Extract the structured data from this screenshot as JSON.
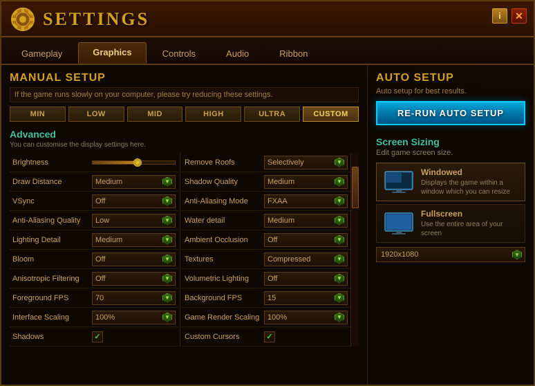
{
  "window": {
    "title": "SETTINGS",
    "close_label": "✕",
    "info_label": "i"
  },
  "tabs": [
    {
      "label": "Gameplay",
      "active": false
    },
    {
      "label": "Graphics",
      "active": true
    },
    {
      "label": "Controls",
      "active": false
    },
    {
      "label": "Audio",
      "active": false
    },
    {
      "label": "Ribbon",
      "active": false
    }
  ],
  "manual_setup": {
    "header": "MANUAL SETUP",
    "description": "If the game runs slowly on your computer, please try reducing these settings.",
    "presets": [
      "MIN",
      "LOW",
      "MID",
      "HIGH",
      "ULTRA",
      "CUSTOM"
    ],
    "active_preset": "CUSTOM"
  },
  "advanced": {
    "header": "Advanced",
    "description": "You can customise the display settings here."
  },
  "settings_left": [
    {
      "label": "Brightness",
      "type": "slider",
      "value": "55"
    },
    {
      "label": "Draw Distance",
      "type": "dropdown",
      "value": "Medium"
    },
    {
      "label": "VSync",
      "type": "dropdown",
      "value": "Off"
    },
    {
      "label": "Anti-Aliasing Quality",
      "type": "dropdown",
      "value": "Low"
    },
    {
      "label": "Lighting Detail",
      "type": "dropdown",
      "value": "Medium"
    },
    {
      "label": "Bloom",
      "type": "dropdown",
      "value": "Off"
    },
    {
      "label": "Anisotropic Filtering",
      "type": "dropdown",
      "value": "Off"
    },
    {
      "label": "Foreground FPS",
      "type": "dropdown",
      "value": "70"
    },
    {
      "label": "Interface Scaling",
      "type": "dropdown",
      "value": "100%"
    },
    {
      "label": "Shadows",
      "type": "checkbox",
      "value": true
    }
  ],
  "settings_right": [
    {
      "label": "Remove Roofs",
      "type": "dropdown",
      "value": "Selectively"
    },
    {
      "label": "Shadow Quality",
      "type": "dropdown",
      "value": "Medium"
    },
    {
      "label": "Anti-Aliasing Mode",
      "type": "dropdown",
      "value": "FXAA"
    },
    {
      "label": "Water detail",
      "type": "dropdown",
      "value": "Medium"
    },
    {
      "label": "Ambient Occlusion",
      "type": "dropdown",
      "value": "Off"
    },
    {
      "label": "Textures",
      "type": "dropdown",
      "value": "Compressed"
    },
    {
      "label": "Volumetric Lighting",
      "type": "dropdown",
      "value": "Off"
    },
    {
      "label": "Background FPS",
      "type": "dropdown",
      "value": "15"
    },
    {
      "label": "Game Render Scaling",
      "type": "dropdown",
      "value": "100%"
    },
    {
      "label": "Custom Cursors",
      "type": "checkbox",
      "value": true
    }
  ],
  "auto_setup": {
    "header": "AUTO SETUP",
    "description": "Auto setup for best results.",
    "button_label": "RE-RUN AUTO SETUP"
  },
  "screen_sizing": {
    "header": "Screen Sizing",
    "description": "Edit game screen size.",
    "options": [
      {
        "label": "Windowed",
        "description": "Displays the game within a window which you can resize",
        "active": true
      },
      {
        "label": "Fullscreen",
        "description": "Use the entire area of your screen",
        "active": false
      }
    ],
    "resolution": "1920x1080"
  }
}
